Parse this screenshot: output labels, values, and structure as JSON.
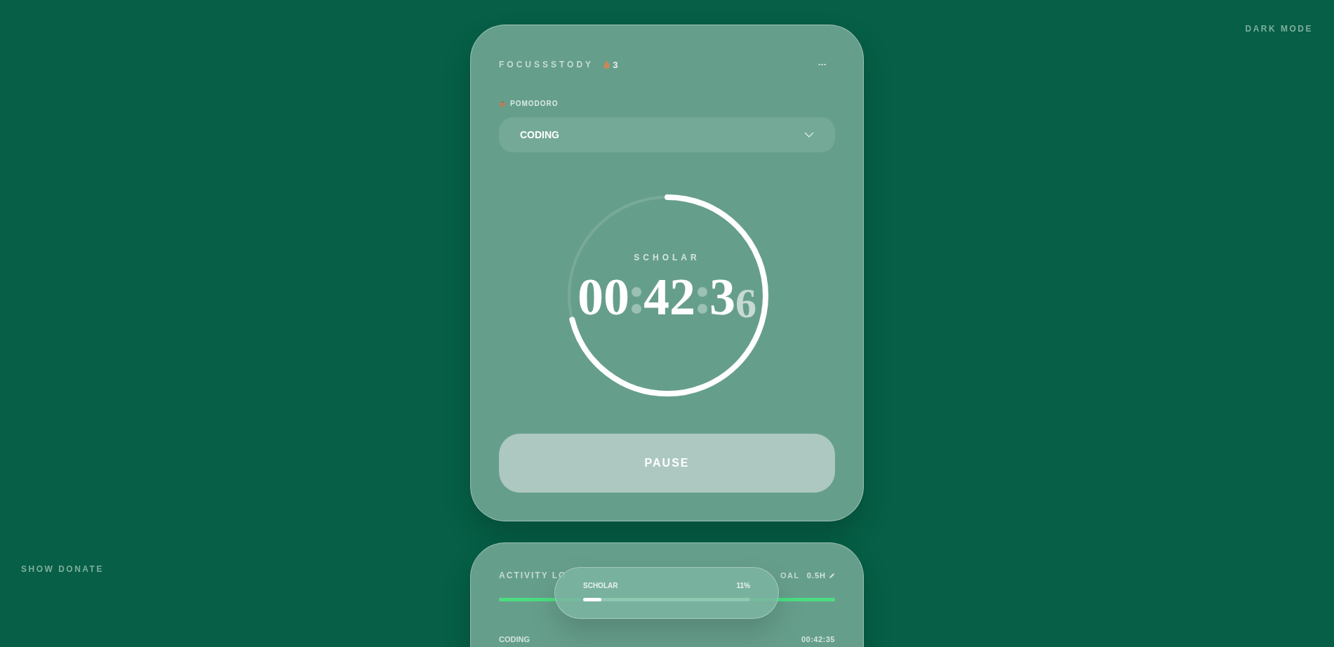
{
  "top_link": "DARK MODE",
  "side_link": "SHOW DONATE",
  "timer_card": {
    "brand": "FOCUSSSTODY",
    "streak": "3",
    "menu": "···",
    "mode_label": "POMODORO",
    "category": {
      "value": "CODING"
    },
    "ring": {
      "level": 0.71,
      "rank": "SCHOLAR",
      "time_parts": [
        "00",
        "42",
        "3"
      ],
      "rolling_digit": "6"
    },
    "action": "PAUSE"
  },
  "log_card": {
    "title": "ACTIVITY LO",
    "goal_label": "OAL",
    "goal_value": "0.5H",
    "goal_bar": {
      "level": 1
    },
    "rows": [
      {
        "name": "CODING",
        "time": "00:42:35"
      }
    ]
  },
  "rank_popup": {
    "rank": "SCHOLAR",
    "percent": "11%",
    "level": 0.11
  }
}
